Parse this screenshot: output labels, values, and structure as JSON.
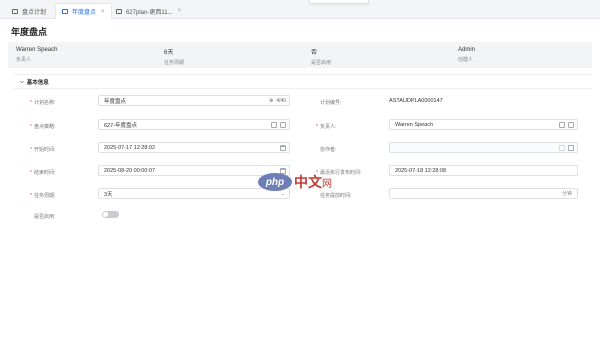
{
  "tabs": [
    {
      "label": "盘点计划",
      "icon": "window-icon",
      "active": false
    },
    {
      "label": "年度盘点",
      "icon": "window-icon",
      "active": true,
      "close": "×"
    },
    {
      "label": "627plan-更西11...",
      "icon": "window-icon",
      "active": false,
      "close": "×"
    }
  ],
  "page": {
    "title": "年度盘点"
  },
  "summary": [
    {
      "value": "Warren Speach",
      "label": "负责人"
    },
    {
      "value": "6天",
      "label": "任务周期"
    },
    {
      "value": "否",
      "label": "是否启用"
    },
    {
      "value": "Admin",
      "label": "创建人"
    }
  ],
  "section": {
    "title": "基本信息",
    "chevron": "chevron-down-icon"
  },
  "form": {
    "plan_name": {
      "label": "计划名称:",
      "value": "年度盘点",
      "counter": "4/40"
    },
    "plan_no": {
      "label": "计划编号:",
      "value": "ASTAUDPLA0000147"
    },
    "scope": {
      "label": "盘点策略:",
      "value": "627-年度盘点"
    },
    "owner": {
      "label": "负责人:",
      "value": "Warren Speach"
    },
    "start_time": {
      "label": "开始时间:",
      "value": "2025-07-17 12:28:02"
    },
    "participants": {
      "label": "协作者:",
      "value": ""
    },
    "end_time": {
      "label": "结束时间:",
      "value": "2025-08-20 00:00:07"
    },
    "next_time": {
      "label": "最近执行发布时间:",
      "value": "2025-07-18 12:28:08"
    },
    "cycle": {
      "label": "任务周期:",
      "value": "3天"
    },
    "advance": {
      "label": "任务提前时间:",
      "value": "",
      "unit": "分钟"
    },
    "enabled": {
      "label": "是否启用:",
      "on": false
    }
  },
  "watermark": {
    "logo": "php",
    "cn": "中文",
    "net": "网"
  }
}
